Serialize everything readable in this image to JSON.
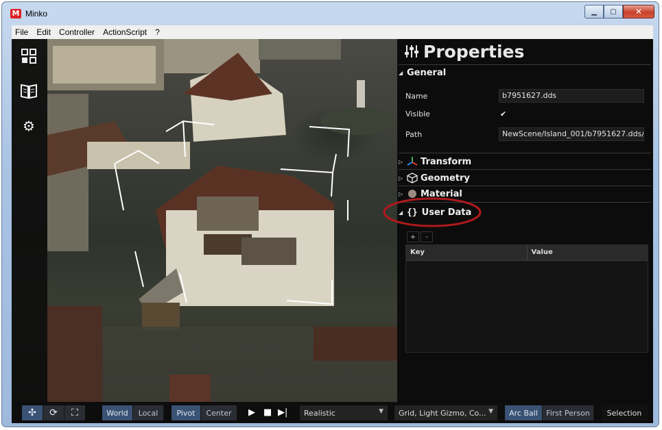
{
  "window": {
    "title": "Minko",
    "controls": {
      "minimize": "▁",
      "maximize": "▢",
      "close": "✕"
    }
  },
  "menu": [
    "File",
    "Edit",
    "Controller",
    "ActionScript",
    "?"
  ],
  "toolstrip": {
    "icons": [
      "scene-graph-icon",
      "library-book-icon",
      "gear-icon"
    ]
  },
  "properties": {
    "title": "Properties",
    "sections": {
      "general": "General",
      "transform": "Transform",
      "geometry": "Geometry",
      "material": "Material",
      "user_data": "User Data"
    },
    "fields": {
      "name_label": "Name",
      "name_value": "b7951627.dds",
      "visible_label": "Visible",
      "visible_check": "✔",
      "path_label": "Path",
      "path_value": "NewScene/Island_001/b7951627.dds/"
    },
    "user_data": {
      "add": "+",
      "remove": "-",
      "columns": [
        "Key",
        "Value"
      ],
      "rows": []
    }
  },
  "bottom_bar": {
    "space": {
      "world": "World",
      "local": "Local",
      "selected": "World"
    },
    "pivot": {
      "pivot": "Pivot",
      "center": "Center",
      "selected": "Pivot"
    },
    "playback": {
      "play": "▶",
      "stop": "■",
      "next": "▶|"
    },
    "render_mode": "Realistic",
    "helpers": "Grid, Light Gizmo, Co...",
    "camera": {
      "arcball": "Arc Ball",
      "first_person": "First Person",
      "selected": "Arc Ball"
    },
    "selection": "Selection"
  },
  "colors": {
    "accent": "#3a5274",
    "highlight_circle": "#b0191d",
    "panel_bg": "#0c0c0c"
  }
}
